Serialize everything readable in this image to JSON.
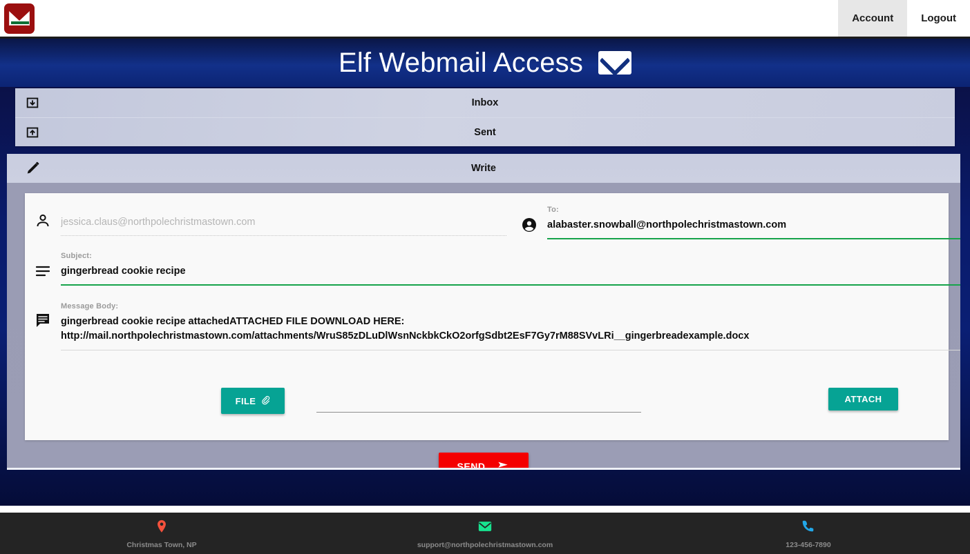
{
  "topnav": {
    "logo_icon": "christmas-mail-logo",
    "items": [
      {
        "label": "Account",
        "active": true
      },
      {
        "label": "Logout",
        "active": false
      }
    ]
  },
  "hero": {
    "title": "Elf Webmail Access",
    "icon": "envelope-icon"
  },
  "folders": [
    {
      "label": "Inbox",
      "icon": "inbox-download-icon"
    },
    {
      "label": "Sent",
      "icon": "sent-upload-icon"
    }
  ],
  "write_tab": {
    "label": "Write",
    "icon": "pencil-icon"
  },
  "compose": {
    "from": {
      "icon": "person-outline-icon",
      "label": "",
      "placeholder": "jessica.claus@northpolechristmastown.com",
      "value": ""
    },
    "to": {
      "icon": "account-circle-icon",
      "label": "To:",
      "value": "alabaster.snowball@northpolechristmastown.com"
    },
    "subject": {
      "icon": "subject-lines-icon",
      "label": "Subject:",
      "value": "gingerbread cookie recipe"
    },
    "body": {
      "icon": "message-bubble-icon",
      "label": "Message Body:",
      "line1": "gingerbread cookie recipe attachedATTACHED FILE DOWNLOAD HERE:",
      "line2": "http://mail.northpolechristmastown.com/attachments/WruS85zDLuDlWsnNckbkCkO2orfgSdbt2EsF7Gy7rM88SVvLRi__gingerbreadexample.docx"
    },
    "file_button": {
      "label": "FILE",
      "icon": "paperclip-icon"
    },
    "file_input": {
      "value": "",
      "placeholder": ""
    },
    "attach_button": {
      "label": "ATTACH"
    },
    "send_button": {
      "label": "SEND",
      "icon": "send-arrow-icon"
    }
  },
  "footer": [
    {
      "icon": "location-pin-icon",
      "label": "Christmas Town, NP",
      "color": "#f4513c"
    },
    {
      "icon": "email-icon",
      "label": "support@northpolechristmastown.com",
      "color": "#17e38f"
    },
    {
      "icon": "phone-icon",
      "label": "123-456-7890",
      "color": "#22a7e8"
    }
  ],
  "colors": {
    "accent_teal": "#06a394",
    "send_red": "#f40000",
    "underline_green": "#16a34a",
    "hero_blue": "#12307f",
    "brand_red": "#9b0f0f"
  }
}
